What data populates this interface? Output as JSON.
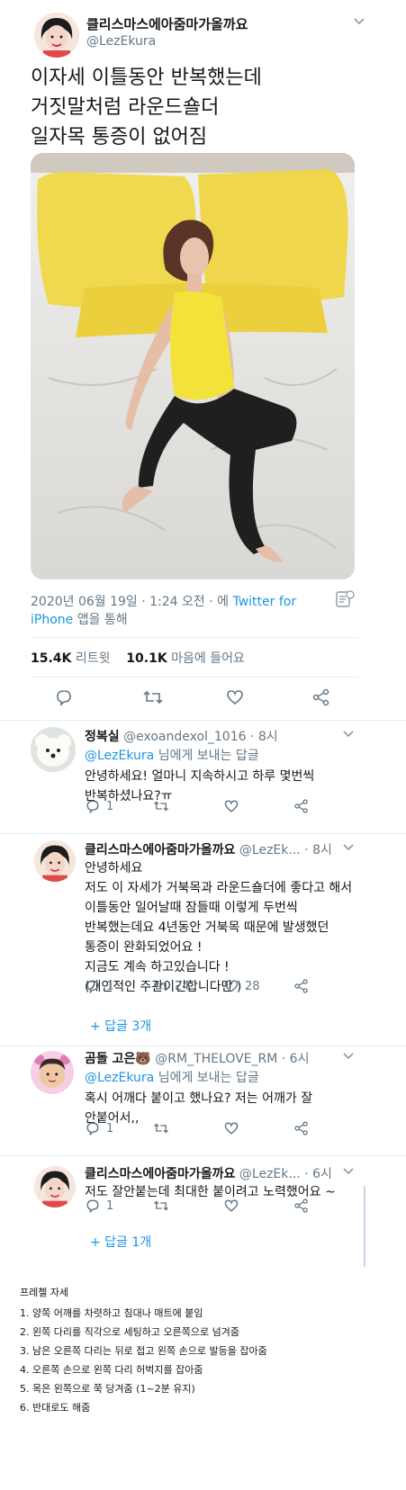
{
  "main_tweet": {
    "display_name": "클리스마스에아줌마가올까요",
    "handle": "@LezEkura",
    "text_lines": [
      "이자세 이틀동안 반복했는데",
      "거짓말처럼 라운드숄더",
      "일자목 통증이 없어짐"
    ],
    "meta_date": "2020년 06월 19일 · 1:24 오전 · 에 ",
    "meta_source": "Twitter for",
    "meta_source2": "iPhone",
    "meta_tail": " 앱을 통해",
    "retweets_count": "15.4K",
    "retweets_label": "리트윗",
    "likes_count": "10.1K",
    "likes_label": "마음에 들어요"
  },
  "replies": [
    {
      "display_name": "정복실",
      "handle": "@exoandexol_1016",
      "time": "· 8시",
      "replying_handle": "@LezEkura",
      "replying_suffix": " 님에게 보내는 답글",
      "lines": [
        "안녕하세요! 얼마니 지속하시고 하루 몇번씩",
        "반복하셨나요?ㅠ"
      ],
      "reply_count": "1",
      "retweet_count": "",
      "like_count": ""
    },
    {
      "display_name": "클리스마스에아줌마가올까요",
      "handle": "@LezEk...",
      "time": "· 8시",
      "lines": [
        "안녕하세요",
        "저도 이 자세가 거북목과 라운드숄더에 좋다고 해서",
        "이틀동안 일어날때 잠들때 이렇게 두번씩",
        "반복했는데요 4년동안 거북목 때문에 발생했던",
        "통증이 완화되었어요 !",
        "지금도 계속 하고있습니다 !",
        "(개인적인 주관이긴합니다만 )"
      ],
      "reply_count": "1",
      "retweet_count": "24",
      "like_count": "28",
      "more_replies": "+ 답글 3개"
    },
    {
      "display_name": "곰돌 고은🐻",
      "handle": "@RM_THELOVE_RM",
      "time": "· 6시",
      "replying_handle": "@LezEkura",
      "replying_suffix": " 님에게 보내는 답글",
      "lines": [
        "혹시 어깨다 붙이고 했나요? 저는 어깨가 잘",
        "안붙어서,,"
      ],
      "reply_count": "1",
      "retweet_count": "",
      "like_count": ""
    },
    {
      "display_name": "클리스마스에아줌마가올까요",
      "handle": "@LezEk...",
      "time": "· 6시",
      "lines": [
        "저도 잘안붙는데 최대한 붙이려고 노력했어요 ~"
      ],
      "reply_count": "1",
      "retweet_count": "",
      "like_count": "",
      "more_replies": "+ 답글 1개"
    }
  ],
  "notes": {
    "title": "프레첼 자세",
    "items": [
      "1. 양쪽 어깨를 차렷하고 침대나 매트에 붙임",
      "2. 왼쪽 다리를 직각으로 세팅하고 오른쪽으로 넘겨줌",
      "3. 남은 오른쪽 다리는 뒤로 접고 왼쪽 손으로 발등을 잡아줌",
      "4. 오른쪽 손으로 왼쪽 다리 허벅지를 잡아줌",
      "5. 목은 왼쪽으로 쭉 당겨줌 (1~2분 유지)",
      "6. 반대로도 해줌"
    ]
  },
  "colors": {
    "link": "#1b95e0",
    "muted": "#657786",
    "divider": "#e6ecf0",
    "shirt_yellow": "#f2e23a"
  },
  "icons": [
    "reply-icon",
    "retweet-icon",
    "like-icon",
    "share-icon",
    "chevron-down-icon",
    "translate-icon"
  ]
}
